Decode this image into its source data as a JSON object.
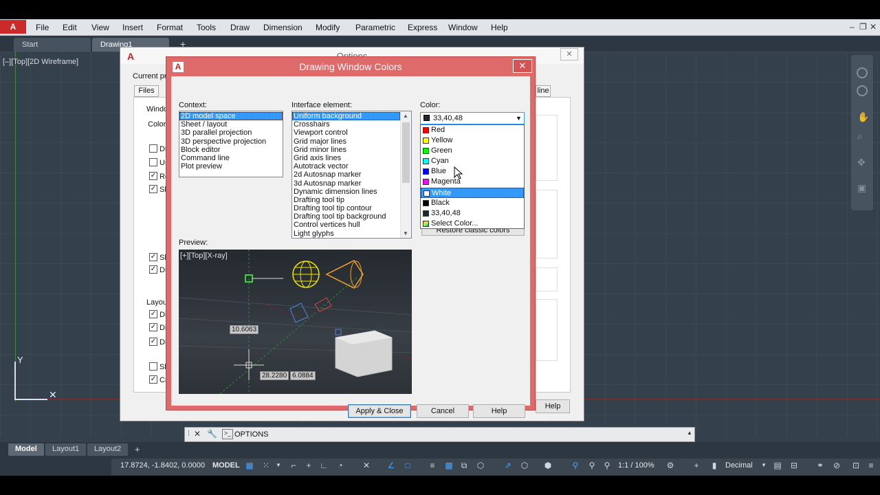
{
  "menubar": {
    "items": [
      "File",
      "Edit",
      "View",
      "Insert",
      "Format",
      "Tools",
      "Draw",
      "Dimension",
      "Modify",
      "Parametric",
      "Express",
      "Window",
      "Help"
    ]
  },
  "doc_tabs": [
    "Start",
    "Drawing1"
  ],
  "viewport_label": "[–][Top][2D Wireframe]",
  "ucs": {
    "y": "Y"
  },
  "options_dialog": {
    "title": "Options",
    "current_profile": "Current pro",
    "files_tab": "Files",
    "line_tab": "line",
    "window_group": "Windo",
    "color_label": "Color s",
    "rows_top": [
      "Dis",
      "Us",
      "Re",
      "Sh"
    ],
    "rows_mid": [
      "Sh",
      "Dis"
    ],
    "layout_group": "Layout",
    "rows_layout": [
      "Dis",
      "Dis",
      "Dis",
      "Sh",
      "Cre"
    ],
    "help_label": "Help"
  },
  "dwc": {
    "title": "Drawing Window Colors",
    "context_label": "Context:",
    "context_items": [
      "2D model space",
      "Sheet / layout",
      "3D parallel projection",
      "3D perspective projection",
      "Block editor",
      "Command line",
      "Plot preview"
    ],
    "context_selected": "2D model space",
    "interface_label": "Interface element:",
    "interface_items": [
      "Uniform background",
      "Crosshairs",
      "Viewport control",
      "Grid major lines",
      "Grid minor lines",
      "Grid axis lines",
      "Autotrack vector",
      "2d Autosnap marker",
      "3d Autosnap marker",
      "Dynamic dimension lines",
      "Drafting tool tip",
      "Drafting tool tip contour",
      "Drafting tool tip background",
      "Control vertices hull",
      "Light glyphs"
    ],
    "color_label": "Color:",
    "color_value": "33,40,48",
    "restore_label": "Restore classic colors",
    "preview_label": "Preview:",
    "preview_view": "[+][Top][X-ray]",
    "dim1": "10.6063",
    "dim2": "28.2280",
    "dim3": "6.0884",
    "apply_label": "Apply & Close",
    "cancel_label": "Cancel",
    "help_label": "Help"
  },
  "color_options": [
    {
      "label": "Red",
      "color": "#ff0000"
    },
    {
      "label": "Yellow",
      "color": "#ffff00"
    },
    {
      "label": "Green",
      "color": "#00ff00"
    },
    {
      "label": "Cyan",
      "color": "#00ffff"
    },
    {
      "label": "Blue",
      "color": "#0000ff"
    },
    {
      "label": "Magenta",
      "color": "#ff00ff"
    },
    {
      "label": "White",
      "color": "#ffffff"
    },
    {
      "label": "Black",
      "color": "#000000"
    },
    {
      "label": "33,40,48",
      "color": "#212830"
    },
    {
      "label": "Select Color...",
      "color": "#7a9bc2"
    }
  ],
  "color_highlighted": "White",
  "command_line": "OPTIONS",
  "layout_tabs": [
    "Model",
    "Layout1",
    "Layout2"
  ],
  "statusbar": {
    "coords": "17.8724, -1.8402, 0.0000",
    "model": "MODEL",
    "scale": "1:1 / 100%",
    "units": "Decimal"
  }
}
